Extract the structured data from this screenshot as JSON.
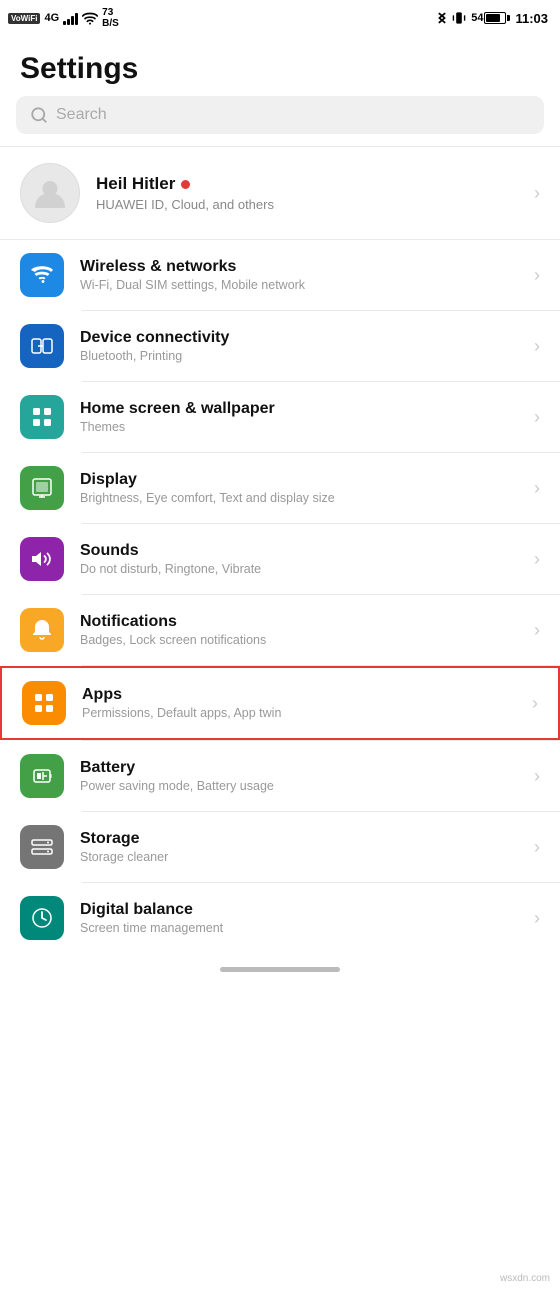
{
  "statusBar": {
    "left": {
      "vowifi": "VoWiFi",
      "signal4g": "4G",
      "signalBars": 4,
      "wifi": "wifi",
      "speed": "73",
      "speedUnit": "B/S"
    },
    "right": {
      "bluetooth": "bluetooth",
      "vibrate": "vibrate",
      "battery": "54",
      "time": "11:03"
    }
  },
  "pageTitle": "Settings",
  "search": {
    "placeholder": "Search"
  },
  "profile": {
    "name": "Heil Hitler",
    "dot": "online",
    "subtitle": "HUAWEI ID, Cloud, and others"
  },
  "settingsItems": [
    {
      "id": "wireless",
      "title": "Wireless & networks",
      "subtitle": "Wi-Fi, Dual SIM settings, Mobile network",
      "iconColor": "blue",
      "icon": "wifi"
    },
    {
      "id": "connectivity",
      "title": "Device connectivity",
      "subtitle": "Bluetooth, Printing",
      "iconColor": "blue-dark",
      "icon": "devices"
    },
    {
      "id": "homescreen",
      "title": "Home screen & wallpaper",
      "subtitle": "Themes",
      "iconColor": "green-teal",
      "icon": "home"
    },
    {
      "id": "display",
      "title": "Display",
      "subtitle": "Brightness, Eye comfort, Text and display size",
      "iconColor": "green-teal",
      "icon": "display"
    },
    {
      "id": "sounds",
      "title": "Sounds",
      "subtitle": "Do not disturb, Ringtone, Vibrate",
      "iconColor": "purple",
      "icon": "sound"
    },
    {
      "id": "notifications",
      "title": "Notifications",
      "subtitle": "Badges, Lock screen notifications",
      "iconColor": "yellow",
      "icon": "bell"
    },
    {
      "id": "apps",
      "title": "Apps",
      "subtitle": "Permissions, Default apps, App twin",
      "iconColor": "orange",
      "icon": "apps",
      "highlighted": true
    },
    {
      "id": "battery",
      "title": "Battery",
      "subtitle": "Power saving mode, Battery usage",
      "iconColor": "green",
      "icon": "battery"
    },
    {
      "id": "storage",
      "title": "Storage",
      "subtitle": "Storage cleaner",
      "iconColor": "grey",
      "icon": "storage"
    },
    {
      "id": "digitalbalance",
      "title": "Digital balance",
      "subtitle": "Screen time management",
      "iconColor": "teal",
      "icon": "balance"
    }
  ],
  "watermark": "wsxdn.com"
}
